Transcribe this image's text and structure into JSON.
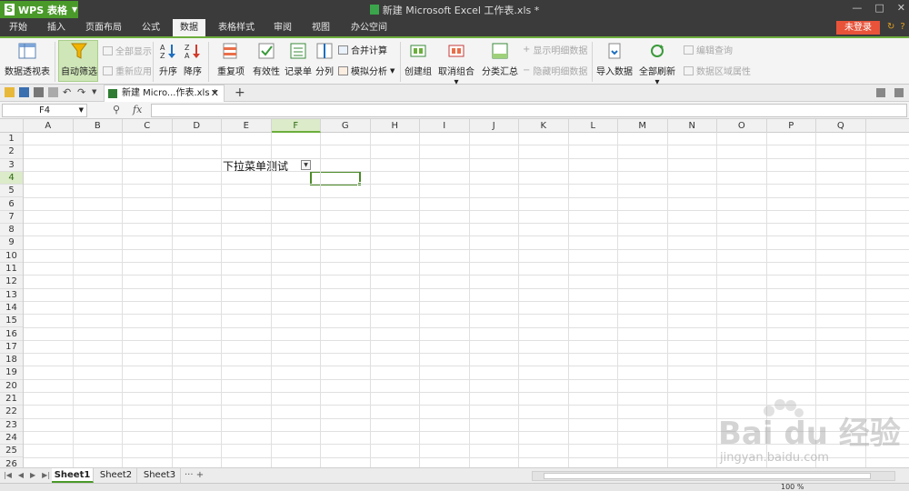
{
  "app": {
    "wps_button": "WPS 表格",
    "doc_title": "新建 Microsoft Excel 工作表.xls *"
  },
  "menu": {
    "tabs": [
      "开始",
      "插入",
      "页面布局",
      "公式",
      "数据",
      "表格样式",
      "审阅",
      "视图",
      "办公空间"
    ],
    "active_tab": "数据",
    "login_label": "未登录"
  },
  "ribbon": {
    "pivot": "数据透视表",
    "autofilter": "自动筛选",
    "show_all": "全部显示",
    "reapply": "重新应用",
    "sort_asc": "升序",
    "sort_desc": "降序",
    "duplicates": "重复项",
    "validity": "有效性",
    "record": "记录单",
    "split": "分列",
    "consolidate": "合并计算",
    "simulate": "模拟分析",
    "group": "创建组",
    "ungroup": "取消组合",
    "subtotal": "分类汇总",
    "show_detail": "显示明细数据",
    "hide_detail": "隐藏明细数据",
    "import": "导入数据",
    "refresh_all": "全部刷新",
    "edit_query": "编辑查询",
    "range_props": "数据区域属性"
  },
  "doc_tab": {
    "label": "新建 Micro...作表.xls *"
  },
  "formula_bar": {
    "name_box": "F4",
    "fx": "fx",
    "formula": ""
  },
  "grid": {
    "columns": [
      "A",
      "B",
      "C",
      "D",
      "E",
      "F",
      "G",
      "H",
      "I",
      "J",
      "K",
      "L",
      "M",
      "N",
      "O",
      "P",
      "Q"
    ],
    "selected_column": "F",
    "selected_row": "4",
    "rows": [
      "1",
      "2",
      "3",
      "4",
      "5",
      "6",
      "7",
      "8",
      "9",
      "10",
      "11",
      "12",
      "13",
      "14",
      "15",
      "16",
      "17",
      "18",
      "19",
      "20",
      "21",
      "22",
      "23",
      "24",
      "25",
      "26"
    ],
    "cell_e2": "下拉菜单测试"
  },
  "sheets": {
    "tabs": [
      "Sheet1",
      "Sheet2",
      "Sheet3"
    ],
    "active": "Sheet1",
    "more": "··· +"
  },
  "status": {
    "zoom": "100 %"
  },
  "watermark": {
    "text": "Bai du 经验",
    "sub": "jingyan.baidu.com"
  },
  "colors": {
    "accent_green": "#4a9a2a",
    "title_bar": "#3b3b3b",
    "login_red": "#e8533a"
  }
}
